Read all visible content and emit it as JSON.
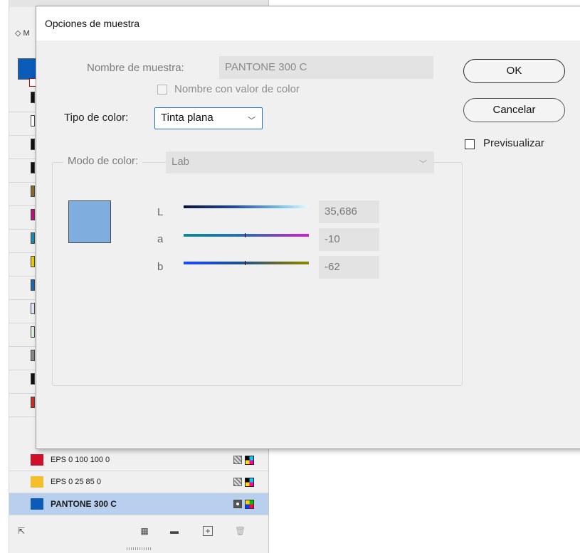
{
  "dialog": {
    "title": "Opciones de muestra",
    "swatch_name_label": "Nombre de muestra:",
    "swatch_name_value": "PANTONE 300 C",
    "name_with_color_value_label": "Nombre con valor de color",
    "name_with_color_value_checked": false,
    "color_type_label": "Tipo de color:",
    "color_type_value": "Tinta plana",
    "color_mode_label": "Modo de color:",
    "color_mode_value": "Lab",
    "preview_color": "#7faede",
    "channels": [
      {
        "label": "L",
        "value": "35,686",
        "gradient": "linear-gradient(90deg,#0a1240,#1a4aa0 40%,#7fc8f0 80%,#e6fbff)"
      },
      {
        "label": "a",
        "value": "-10",
        "gradient": "linear-gradient(90deg,#0a8a9a,#2a6ab8 50%,#d020d0)"
      },
      {
        "label": "b",
        "value": "-62",
        "gradient": "linear-gradient(90deg,#1a4aff,#1a5090 45%,#706c20 80%,#8c8a00)"
      }
    ],
    "ok_label": "OK",
    "cancel_label": "Cancelar",
    "preview_label": "Previsualizar",
    "preview_checked": false
  },
  "panel": {
    "tab_glyph": "◇ M",
    "rows": [
      {
        "name": "EPS 0 100 100 0",
        "color": "#d0102a",
        "type_icon": "process-icon",
        "mode_icon": "cmyk-icon",
        "selected": false
      },
      {
        "name": "EPS 0 25 85 0",
        "color": "#f6be2a",
        "type_icon": "process-icon",
        "mode_icon": "cmyk-icon",
        "selected": false
      },
      {
        "name": "PANTONE 300 C",
        "color": "#0a5cb8",
        "type_icon": "spot-icon",
        "mode_icon": "lab-icon",
        "selected": true
      }
    ],
    "left_chips": [
      "#111111",
      "#ffffff",
      "#111111",
      "#111111",
      "#8a6a30",
      "#c01080",
      "#1a8ab0",
      "#e8c800",
      "#1a6ab0",
      "#dfe8f6",
      "#d8eed8",
      "#888888",
      "#111111",
      "#c83020"
    ],
    "footer_icons": [
      "load-swatches-icon",
      "swatch-library-icon",
      "new-group-icon",
      "new-swatch-icon",
      "delete-icon"
    ]
  }
}
